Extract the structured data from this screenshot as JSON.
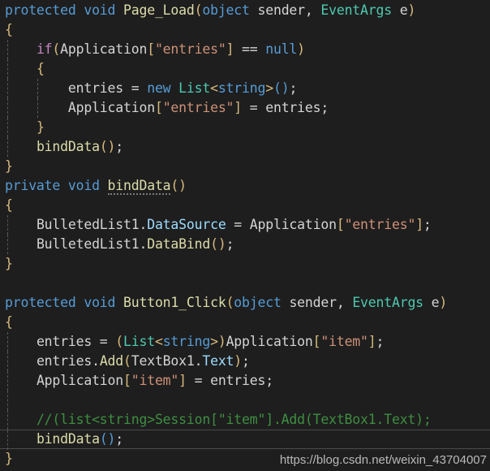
{
  "editor": {
    "background": "#1e1e1e",
    "default_text_color": "#d4d4d4",
    "font_size_px": 16.5,
    "line_height_px": 24,
    "current_line_index": 22,
    "colors": {
      "keyword": "#569cd6",
      "control_keyword": "#c586c0",
      "method": "#dcdcaa",
      "type": "#4ec9b0",
      "string": "#ce9178",
      "identifier": "#9cdcfe",
      "comment": "#3e8e41",
      "bracket_gold": "#d7ba7d",
      "bracket_blue": "#569cd6",
      "indent_guide": "#5a5a5a",
      "current_line_border": "#4a4a4a"
    },
    "language": "C#",
    "lines": [
      {
        "n": 1,
        "guides": [],
        "tokens": [
          {
            "t": "protected",
            "c": "kw"
          },
          {
            "t": " ",
            "c": "plain"
          },
          {
            "t": "void",
            "c": "kw"
          },
          {
            "t": " ",
            "c": "plain"
          },
          {
            "t": "Page_Load",
            "c": "fn"
          },
          {
            "t": "(",
            "c": "br1"
          },
          {
            "t": "object",
            "c": "kw"
          },
          {
            "t": " ",
            "c": "plain"
          },
          {
            "t": "sender",
            "c": "plain"
          },
          {
            "t": ", ",
            "c": "plain"
          },
          {
            "t": "EventArgs",
            "c": "type"
          },
          {
            "t": " ",
            "c": "plain"
          },
          {
            "t": "e",
            "c": "plain"
          },
          {
            "t": ")",
            "c": "br1"
          }
        ]
      },
      {
        "n": 2,
        "guides": [],
        "tokens": [
          {
            "t": "{",
            "c": "br1"
          }
        ]
      },
      {
        "n": 3,
        "guides": [
          "g1"
        ],
        "tokens": [
          {
            "t": "    ",
            "c": "plain"
          },
          {
            "t": "if",
            "c": "ctl"
          },
          {
            "t": "(",
            "c": "br1"
          },
          {
            "t": "Application",
            "c": "plain"
          },
          {
            "t": "[",
            "c": "br1"
          },
          {
            "t": "\"entries\"",
            "c": "str"
          },
          {
            "t": "]",
            "c": "br1"
          },
          {
            "t": " ",
            "c": "plain"
          },
          {
            "t": "==",
            "c": "plain"
          },
          {
            "t": " ",
            "c": "plain"
          },
          {
            "t": "null",
            "c": "kw"
          },
          {
            "t": ")",
            "c": "br1"
          }
        ]
      },
      {
        "n": 4,
        "guides": [
          "g1"
        ],
        "tokens": [
          {
            "t": "    ",
            "c": "plain"
          },
          {
            "t": "{",
            "c": "br1"
          }
        ]
      },
      {
        "n": 5,
        "guides": [
          "g1",
          "g2"
        ],
        "tokens": [
          {
            "t": "        ",
            "c": "plain"
          },
          {
            "t": "entries",
            "c": "plain"
          },
          {
            "t": " = ",
            "c": "plain"
          },
          {
            "t": "new",
            "c": "kw"
          },
          {
            "t": " ",
            "c": "plain"
          },
          {
            "t": "List",
            "c": "type"
          },
          {
            "t": "<",
            "c": "br1"
          },
          {
            "t": "string",
            "c": "kw"
          },
          {
            "t": ">",
            "c": "br1"
          },
          {
            "t": "(",
            "c": "br2"
          },
          {
            "t": ")",
            "c": "br2"
          },
          {
            "t": ";",
            "c": "plain"
          }
        ]
      },
      {
        "n": 6,
        "guides": [
          "g1",
          "g2"
        ],
        "tokens": [
          {
            "t": "        ",
            "c": "plain"
          },
          {
            "t": "Application",
            "c": "plain"
          },
          {
            "t": "[",
            "c": "br1"
          },
          {
            "t": "\"entries\"",
            "c": "str"
          },
          {
            "t": "]",
            "c": "br1"
          },
          {
            "t": " = ",
            "c": "plain"
          },
          {
            "t": "entries",
            "c": "plain"
          },
          {
            "t": ";",
            "c": "plain"
          }
        ]
      },
      {
        "n": 7,
        "guides": [
          "g1"
        ],
        "tokens": [
          {
            "t": "    ",
            "c": "plain"
          },
          {
            "t": "}",
            "c": "br1"
          }
        ]
      },
      {
        "n": 8,
        "guides": [
          "g1"
        ],
        "tokens": [
          {
            "t": "    ",
            "c": "plain"
          },
          {
            "t": "bindData",
            "c": "fn"
          },
          {
            "t": "(",
            "c": "br1"
          },
          {
            "t": ")",
            "c": "br1"
          },
          {
            "t": ";",
            "c": "plain"
          }
        ]
      },
      {
        "n": 9,
        "guides": [],
        "tokens": [
          {
            "t": "}",
            "c": "br1"
          }
        ]
      },
      {
        "n": 10,
        "guides": [],
        "tokens": [
          {
            "t": "private",
            "c": "kw"
          },
          {
            "t": " ",
            "c": "plain"
          },
          {
            "t": "void",
            "c": "kw"
          },
          {
            "t": " ",
            "c": "plain"
          },
          {
            "t": "bindData",
            "c": "fn squiggle"
          },
          {
            "t": "(",
            "c": "br1"
          },
          {
            "t": ")",
            "c": "br1"
          }
        ]
      },
      {
        "n": 11,
        "guides": [],
        "tokens": [
          {
            "t": "{",
            "c": "br1"
          }
        ]
      },
      {
        "n": 12,
        "guides": [
          "g1"
        ],
        "tokens": [
          {
            "t": "    ",
            "c": "plain"
          },
          {
            "t": "BulletedList1",
            "c": "plain"
          },
          {
            "t": ".",
            "c": "plain"
          },
          {
            "t": "DataSource",
            "c": "idn"
          },
          {
            "t": " = ",
            "c": "plain"
          },
          {
            "t": "Application",
            "c": "plain"
          },
          {
            "t": "[",
            "c": "br1"
          },
          {
            "t": "\"entries\"",
            "c": "str"
          },
          {
            "t": "]",
            "c": "br1"
          },
          {
            "t": ";",
            "c": "plain"
          }
        ]
      },
      {
        "n": 13,
        "guides": [
          "g1"
        ],
        "tokens": [
          {
            "t": "    ",
            "c": "plain"
          },
          {
            "t": "BulletedList1",
            "c": "plain"
          },
          {
            "t": ".",
            "c": "plain"
          },
          {
            "t": "DataBind",
            "c": "fn"
          },
          {
            "t": "(",
            "c": "br1"
          },
          {
            "t": ")",
            "c": "br1"
          },
          {
            "t": ";",
            "c": "plain"
          }
        ]
      },
      {
        "n": 14,
        "guides": [],
        "tokens": [
          {
            "t": "}",
            "c": "br1"
          }
        ]
      },
      {
        "n": 15,
        "guides": [],
        "tokens": []
      },
      {
        "n": 16,
        "guides": [],
        "tokens": [
          {
            "t": "protected",
            "c": "kw"
          },
          {
            "t": " ",
            "c": "plain"
          },
          {
            "t": "void",
            "c": "kw"
          },
          {
            "t": " ",
            "c": "plain"
          },
          {
            "t": "Button1_Click",
            "c": "fn"
          },
          {
            "t": "(",
            "c": "br1"
          },
          {
            "t": "object",
            "c": "kw"
          },
          {
            "t": " ",
            "c": "plain"
          },
          {
            "t": "sender",
            "c": "plain"
          },
          {
            "t": ", ",
            "c": "plain"
          },
          {
            "t": "EventArgs",
            "c": "type"
          },
          {
            "t": " ",
            "c": "plain"
          },
          {
            "t": "e",
            "c": "plain"
          },
          {
            "t": ")",
            "c": "br1"
          }
        ]
      },
      {
        "n": 17,
        "guides": [],
        "tokens": [
          {
            "t": "{",
            "c": "br1"
          }
        ]
      },
      {
        "n": 18,
        "guides": [
          "g1"
        ],
        "tokens": [
          {
            "t": "    ",
            "c": "plain"
          },
          {
            "t": "entries",
            "c": "plain"
          },
          {
            "t": " = ",
            "c": "plain"
          },
          {
            "t": "(",
            "c": "br1"
          },
          {
            "t": "List",
            "c": "type"
          },
          {
            "t": "<",
            "c": "br1"
          },
          {
            "t": "string",
            "c": "kw"
          },
          {
            "t": ">",
            "c": "br1"
          },
          {
            "t": ")",
            "c": "br1"
          },
          {
            "t": "Application",
            "c": "plain"
          },
          {
            "t": "[",
            "c": "br1"
          },
          {
            "t": "\"item\"",
            "c": "str"
          },
          {
            "t": "]",
            "c": "br1"
          },
          {
            "t": ";",
            "c": "plain"
          }
        ]
      },
      {
        "n": 19,
        "guides": [
          "g1"
        ],
        "tokens": [
          {
            "t": "    ",
            "c": "plain"
          },
          {
            "t": "entries",
            "c": "plain"
          },
          {
            "t": ".",
            "c": "plain"
          },
          {
            "t": "Add",
            "c": "fn"
          },
          {
            "t": "(",
            "c": "br1"
          },
          {
            "t": "TextBox1",
            "c": "plain"
          },
          {
            "t": ".",
            "c": "plain"
          },
          {
            "t": "Text",
            "c": "idn"
          },
          {
            "t": ")",
            "c": "br1"
          },
          {
            "t": ";",
            "c": "plain"
          }
        ]
      },
      {
        "n": 20,
        "guides": [
          "g1"
        ],
        "tokens": [
          {
            "t": "    ",
            "c": "plain"
          },
          {
            "t": "Application",
            "c": "plain"
          },
          {
            "t": "[",
            "c": "br1"
          },
          {
            "t": "\"item\"",
            "c": "str"
          },
          {
            "t": "]",
            "c": "br1"
          },
          {
            "t": " = ",
            "c": "plain"
          },
          {
            "t": "entries",
            "c": "plain"
          },
          {
            "t": ";",
            "c": "plain"
          }
        ]
      },
      {
        "n": 21,
        "guides": [
          "g1"
        ],
        "tokens": []
      },
      {
        "n": 22,
        "guides": [
          "g1"
        ],
        "tokens": [
          {
            "t": "    ",
            "c": "plain"
          },
          {
            "t": "//(list<string>Session[\"item\"].Add(TextBox1.Text);",
            "c": "cmt"
          }
        ]
      },
      {
        "n": 23,
        "guides": [
          "g1"
        ],
        "current": true,
        "tokens": [
          {
            "t": "    ",
            "c": "plain"
          },
          {
            "t": "bindData",
            "c": "fn"
          },
          {
            "t": "(",
            "c": "br2"
          },
          {
            "t": ")",
            "c": "br2"
          },
          {
            "t": ";",
            "c": "plain"
          }
        ]
      },
      {
        "n": 24,
        "guides": [],
        "tokens": [
          {
            "t": "}",
            "c": "br1"
          }
        ]
      }
    ]
  },
  "watermark": {
    "text": "https://blog.csdn.net/weixin_43704007"
  }
}
